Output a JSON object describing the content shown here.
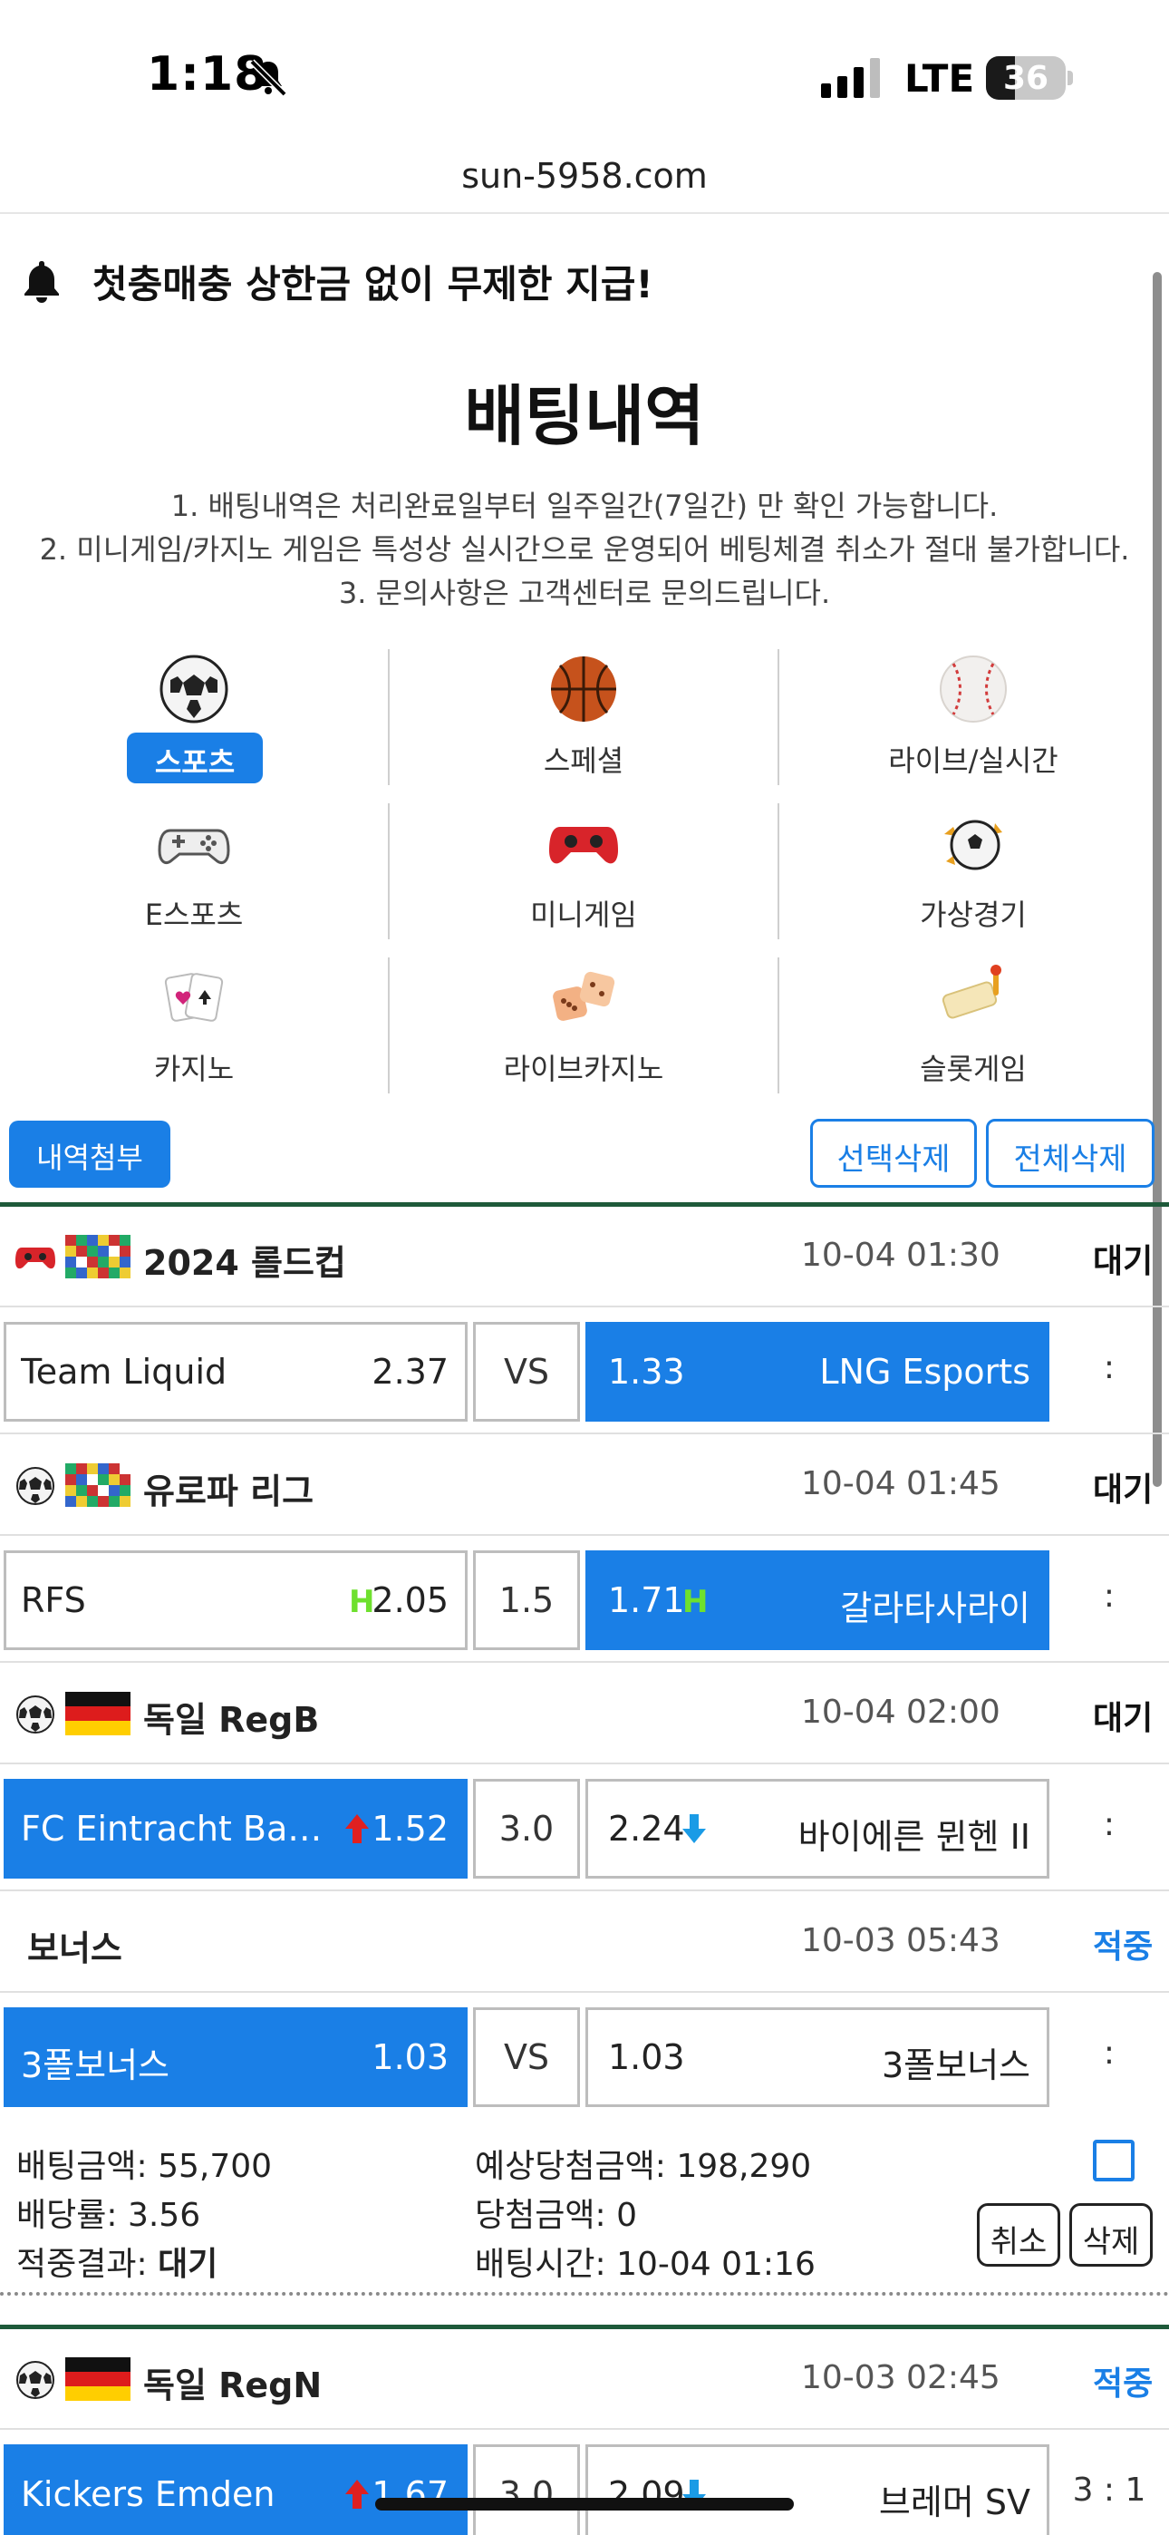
{
  "status_bar": {
    "time": "1:18",
    "network": "LTE",
    "battery": "36",
    "battery_level": 0.36
  },
  "url": "sun-5958.com",
  "notice": "첫충매충 상한금 없이 무제한 지급!",
  "title": "배팅내역",
  "rules": [
    "1. 배팅내역은 처리완료일부터 일주일간(7일간) 만 확인 가능합니다.",
    "2. 미니게임/카지노 게임은 특성상 실시간으로 운영되어 베팅체결 취소가 절대 불가합니다.",
    "3. 문의사항은 고객센터로 문의드립니다."
  ],
  "categories": [
    {
      "label": "스포츠",
      "icon": "soccer-ball-icon",
      "active": true
    },
    {
      "label": "스페셜",
      "icon": "basketball-icon",
      "active": false
    },
    {
      "label": "라이브/실시간",
      "icon": "baseball-icon",
      "active": false
    },
    {
      "label": "E스포츠",
      "icon": "gamepad-icon",
      "active": false
    },
    {
      "label": "미니게임",
      "icon": "red-controller-icon",
      "active": false
    },
    {
      "label": "가상경기",
      "icon": "virtual-soccer-icon",
      "active": false
    },
    {
      "label": "카지노",
      "icon": "cards-icon",
      "active": false
    },
    {
      "label": "라이브카지노",
      "icon": "dice-icon",
      "active": false
    },
    {
      "label": "슬롯게임",
      "icon": "slot-icon",
      "active": false
    }
  ],
  "actions": {
    "attach": "내역첨부",
    "delete_selected": "선택삭제",
    "delete_all": "전체삭제"
  },
  "bet1": {
    "matches": [
      {
        "sport_icon": "gamepad-icon",
        "flag_icon": "world-flags-icon",
        "league": "2024 롤드컵",
        "time": "10-04 01:30",
        "status": "대기",
        "home": "Team Liquid",
        "home_odds": "2.37",
        "mid": "VS",
        "away_odds": "1.33",
        "away": "LNG Esports",
        "score": ":",
        "selected": "away"
      },
      {
        "sport_icon": "soccer-ball-icon",
        "flag_icon": "world-flags-icon",
        "league": "유로파 리그",
        "time": "10-04 01:45",
        "status": "대기",
        "home": "RFS",
        "home_odds": "2.05",
        "mid": "1.5",
        "away_odds": "1.71",
        "away": "갈라타사라이",
        "score": ":",
        "selected": "away",
        "handicap": "H"
      },
      {
        "sport_icon": "soccer-ball-icon",
        "flag_icon": "germany-flag-icon",
        "league": "독일 RegB",
        "time": "10-04 02:00",
        "status": "대기",
        "home": "FC Eintracht Bamberg",
        "home_odds": "1.52",
        "mid": "3.0",
        "away_odds": "2.24",
        "away": "바이에른 뮌헨 II",
        "score": ":",
        "selected": "home"
      },
      {
        "league": "보너스",
        "time": "10-03 05:43",
        "status": "적중",
        "home": "3폴보너스",
        "home_odds": "1.03",
        "mid": "VS",
        "away_odds": "1.03",
        "away": "3폴보너스",
        "score": ":",
        "selected": "home"
      }
    ],
    "summary": {
      "bet_amount_label": "배팅금액:",
      "bet_amount": "55,700",
      "odds_label": "배당률:",
      "odds": "3.56",
      "result_label": "적중결과:",
      "result": "대기",
      "expected_label": "예상당첨금액:",
      "expected": "198,290",
      "win_label": "당첨금액:",
      "win": "0",
      "time_label": "배팅시간:",
      "time": "10-04 01:16",
      "cancel": "취소",
      "delete": "삭제"
    }
  },
  "bet2": {
    "match": {
      "sport_icon": "soccer-ball-icon",
      "flag_icon": "germany-flag-icon",
      "league": "독일 RegN",
      "time": "10-03 02:45",
      "status": "적중",
      "home": "Kickers Emden",
      "home_odds": "1.67",
      "mid": "3.0",
      "away_odds": "2.09",
      "away": "브레머 SV",
      "score": "3 : 1",
      "selected": "home"
    }
  },
  "colors": {
    "accent": "#1a7fe6",
    "divider_green": "#1e5a3a",
    "handicap": "#6ee02e",
    "up_arrow": "#e02020",
    "down_arrow": "#1a9be6"
  }
}
